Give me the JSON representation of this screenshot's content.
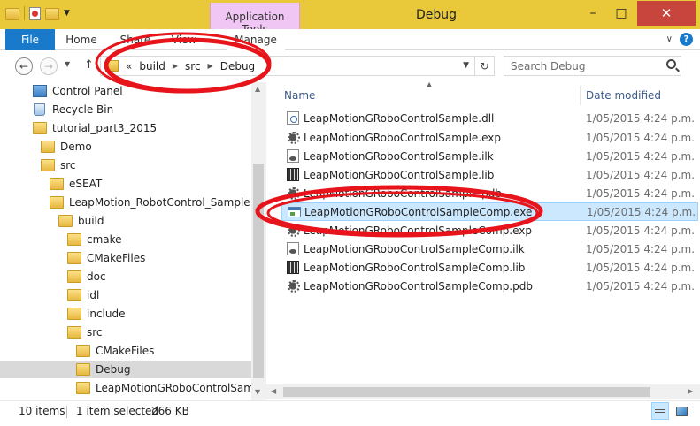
{
  "window": {
    "title": "Debug",
    "contextual_tab": "Application Tools",
    "minimize": "–",
    "maximize": "□",
    "close": "✕"
  },
  "ribbon": {
    "tabs": [
      "File",
      "Home",
      "Share",
      "View",
      "Manage"
    ]
  },
  "nav": {
    "back": "←",
    "forward": "→",
    "recent": "▼",
    "up": "↑",
    "overflow": "«",
    "breadcrumbs": [
      "build",
      "src",
      "Debug"
    ],
    "crumb_separator": "▶",
    "dropdown": "▼",
    "refresh": "↻"
  },
  "search": {
    "placeholder": "Search Debug"
  },
  "tree": [
    {
      "label": "Control Panel",
      "icon": "control-panel-icon"
    },
    {
      "label": "Recycle Bin",
      "icon": "recycle-bin-icon"
    },
    {
      "label": "tutorial_part3_2015",
      "icon": "folder-icon"
    },
    {
      "label": "Demo",
      "icon": "folder-icon"
    },
    {
      "label": "src",
      "icon": "folder-icon"
    },
    {
      "label": "eSEAT",
      "icon": "folder-icon"
    },
    {
      "label": "LeapMotion_RobotControl_Sample",
      "icon": "folder-icon"
    },
    {
      "label": "build",
      "icon": "folder-icon"
    },
    {
      "label": "cmake",
      "icon": "folder-icon"
    },
    {
      "label": "CMakeFiles",
      "icon": "folder-icon"
    },
    {
      "label": "doc",
      "icon": "folder-icon"
    },
    {
      "label": "idl",
      "icon": "folder-icon"
    },
    {
      "label": "include",
      "icon": "folder-icon"
    },
    {
      "label": "src",
      "icon": "folder-icon"
    },
    {
      "label": "CMakeFiles",
      "icon": "folder-icon"
    },
    {
      "label": "Debug",
      "icon": "folder-icon",
      "selected": true
    },
    {
      "label": "LeapMotionGRoboControlSample",
      "icon": "folder-icon"
    }
  ],
  "columns": {
    "sort_indicator": "▲",
    "name": "Name",
    "date_modified": "Date modified"
  },
  "files": [
    {
      "name": "LeapMotionGRoboControlSample.dll",
      "date": "1/05/2015 4:24 p.m.",
      "icon": "dll-icon"
    },
    {
      "name": "LeapMotionGRoboControlSample.exp",
      "date": "1/05/2015 4:24 p.m.",
      "icon": "exp-icon"
    },
    {
      "name": "LeapMotionGRoboControlSample.ilk",
      "date": "1/05/2015 4:24 p.m.",
      "icon": "ilk-icon"
    },
    {
      "name": "LeapMotionGRoboControlSample.lib",
      "date": "1/05/2015 4:24 p.m.",
      "icon": "lib-icon"
    },
    {
      "name": "LeapMotionGRoboControlSample.pdb",
      "date": "1/05/2015 4:24 p.m.",
      "icon": "pdb-icon"
    },
    {
      "name": "LeapMotionGRoboControlSampleComp.exe",
      "date": "1/05/2015 4:24 p.m.",
      "icon": "exe-icon",
      "selected": true
    },
    {
      "name": "LeapMotionGRoboControlSampleComp.exp",
      "date": "1/05/2015 4:24 p.m.",
      "icon": "exp-icon"
    },
    {
      "name": "LeapMotionGRoboControlSampleComp.ilk",
      "date": "1/05/2015 4:24 p.m.",
      "icon": "ilk-icon"
    },
    {
      "name": "LeapMotionGRoboControlSampleComp.lib",
      "date": "1/05/2015 4:24 p.m.",
      "icon": "lib-icon"
    },
    {
      "name": "LeapMotionGRoboControlSampleComp.pdb",
      "date": "1/05/2015 4:24 p.m.",
      "icon": "pdb-icon"
    }
  ],
  "status": {
    "item_count": "10 items",
    "selection": "1 item selected",
    "size": "266 KB"
  },
  "scroll": {
    "up": "▲",
    "down": "▼",
    "left": "◀",
    "right": "▶"
  },
  "colors": {
    "title_bar": "#e9c93a",
    "file_tab": "#1979ca",
    "application_tools": "#f0c7f4",
    "selection": "#cce8ff",
    "annotation": "#e8141b"
  }
}
